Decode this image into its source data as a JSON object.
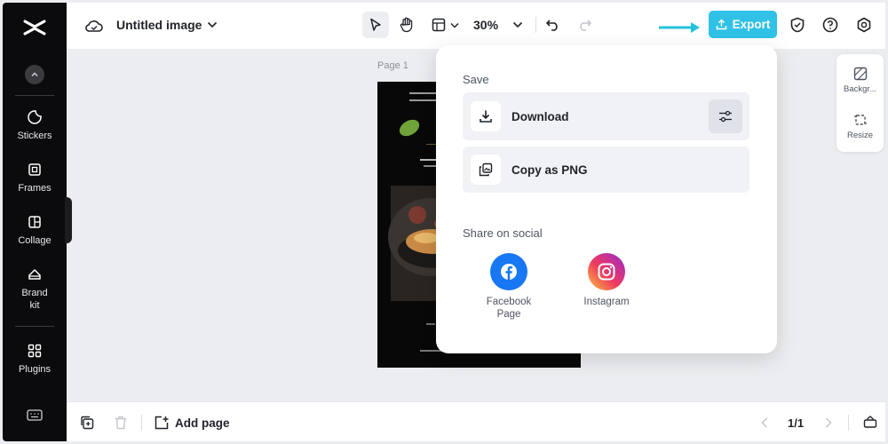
{
  "sidebar": {
    "items": [
      {
        "label": "Stickers"
      },
      {
        "label": "Frames"
      },
      {
        "label": "Collage"
      },
      {
        "label": "Brand kit"
      },
      {
        "label": "Plugins"
      }
    ]
  },
  "topbar": {
    "title": "Untitled image",
    "zoom": "30%",
    "export_label": "Export"
  },
  "canvas": {
    "page_label": "Page 1"
  },
  "right_panel": {
    "items": [
      {
        "label": "Backgr..."
      },
      {
        "label": "Resize"
      }
    ]
  },
  "bottombar": {
    "add_page_label": "Add page",
    "page_count": "1/1"
  },
  "export_menu": {
    "save_heading": "Save",
    "download_label": "Download",
    "copy_label": "Copy as PNG",
    "share_heading": "Share on social",
    "social": [
      {
        "label": "Facebook Page"
      },
      {
        "label": "Instagram"
      }
    ]
  },
  "colors": {
    "accent": "#30c2e6",
    "sidebar_bg": "#0b0b0d",
    "facebook": "#1877f2"
  }
}
